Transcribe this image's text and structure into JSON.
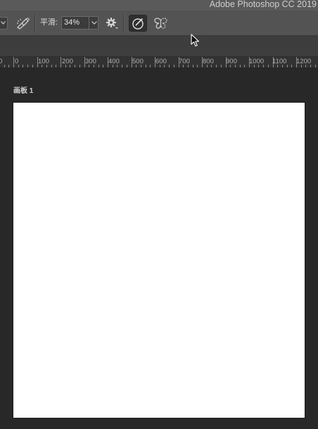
{
  "titlebar": {
    "app_title": "Adobe Photoshop CC 2019"
  },
  "options_bar": {
    "brush_mode_dropdown": {
      "icon": "chevron-down-icon"
    },
    "airbrush_icon": "airbrush-icon",
    "smoothing": {
      "label": "平滑:",
      "value": "34%",
      "icon": "chevron-down-icon"
    },
    "settings_icon": "gear-icon",
    "pressure_toggle": {
      "icon": "pressure-size-icon",
      "active": true
    },
    "symmetry_icon": "butterfly-symmetry-icon"
  },
  "ruler": {
    "labels": [
      "0",
      "0",
      "100",
      "200",
      "300",
      "400",
      "500",
      "600",
      "700",
      "800",
      "900",
      "1000",
      "1100",
      "1200"
    ]
  },
  "canvas": {
    "artboard_label": "画板 1",
    "artboard_fill": "#ffffff",
    "workspace_background": "#282828"
  },
  "colors": {
    "titlebar": "#5a5a5a",
    "options_bar": "#535353",
    "panel_bar": "#3d3d3d",
    "ruler": "#323232"
  }
}
